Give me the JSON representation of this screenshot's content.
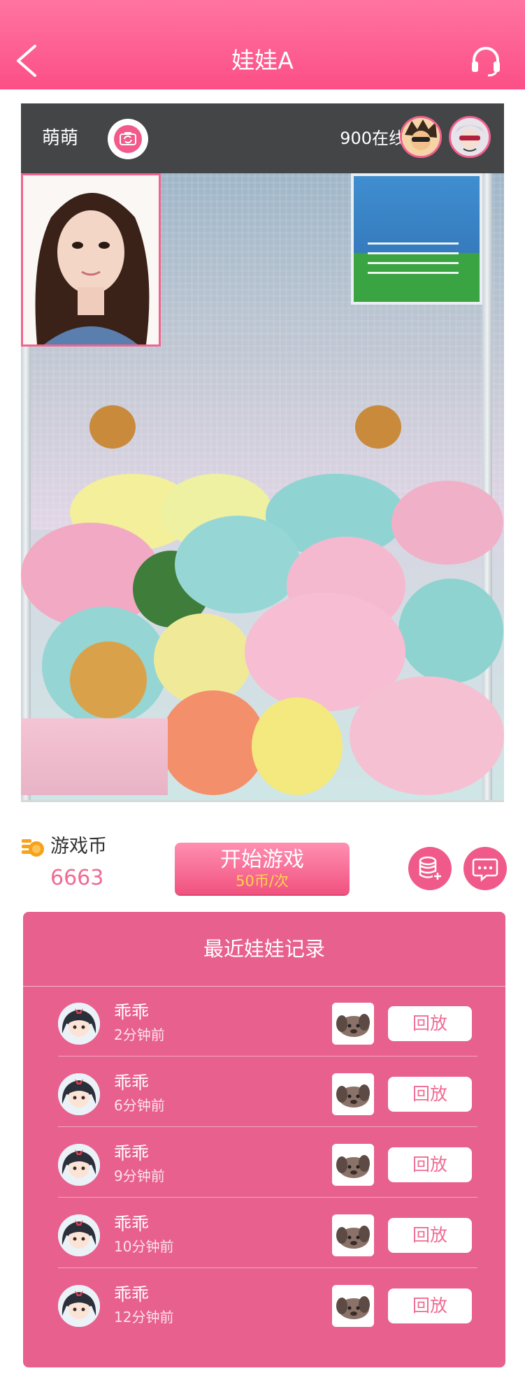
{
  "header": {
    "title": "娃娃A"
  },
  "live": {
    "streamer_name": "萌萌",
    "online_count": "900在线",
    "viewers": [
      {
        "name": "viewer-avatar-1"
      },
      {
        "name": "viewer-avatar-2"
      }
    ]
  },
  "controls": {
    "coins_label": "游戏币",
    "coins_value": "6663",
    "start_label": "开始游戏",
    "start_price": "50币/次"
  },
  "records": {
    "title": "最近娃娃记录",
    "items": [
      {
        "user": "乖乖",
        "time": "2分钟前",
        "action": "回放"
      },
      {
        "user": "乖乖",
        "time": "6分钟前",
        "action": "回放"
      },
      {
        "user": "乖乖",
        "time": "9分钟前",
        "action": "回放"
      },
      {
        "user": "乖乖",
        "time": "10分钟前",
        "action": "回放"
      },
      {
        "user": "乖乖",
        "time": "12分钟前",
        "action": "回放"
      }
    ]
  },
  "colors": {
    "brand_pink": "#fc4f86",
    "panel_pink": "#e8608d",
    "coin_orange": "#f7a21b",
    "price_yellow": "#ffd54a"
  },
  "icons": [
    "back-arrow-icon",
    "headset-icon",
    "camera-switch-icon",
    "coin-stack-icon",
    "coins-add-icon",
    "chat-icon"
  ]
}
